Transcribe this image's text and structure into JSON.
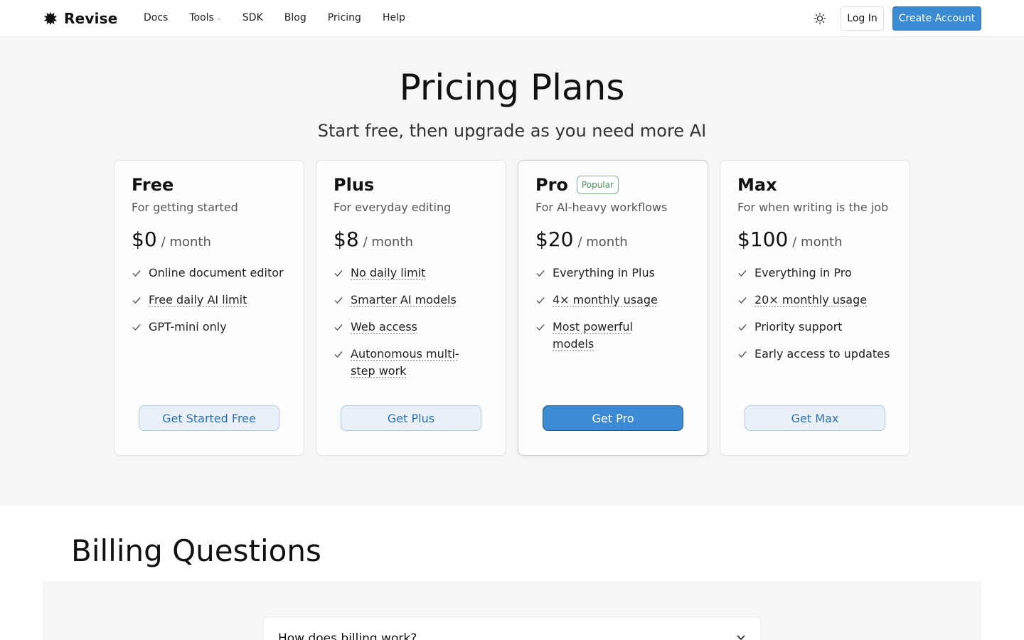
{
  "header": {
    "brand": "Revise",
    "nav": [
      {
        "label": "Docs"
      },
      {
        "label": "Tools",
        "has_dropdown": true
      },
      {
        "label": "SDK"
      },
      {
        "label": "Blog"
      },
      {
        "label": "Pricing"
      },
      {
        "label": "Help"
      }
    ],
    "login_label": "Log In",
    "create_account_label": "Create Account"
  },
  "hero": {
    "title": "Pricing Plans",
    "subtitle": "Start free, then upgrade as you need more AI"
  },
  "plans": [
    {
      "name": "Free",
      "description": "For getting started",
      "price": "$0",
      "period": "/ month",
      "features": [
        {
          "text": "Online document editor",
          "dotted": false
        },
        {
          "text": "Free daily AI limit",
          "dotted": true
        },
        {
          "text": "GPT-mini only",
          "dotted": false
        }
      ],
      "cta": "Get Started Free",
      "primary": false
    },
    {
      "name": "Plus",
      "description": "For everyday editing",
      "price": "$8",
      "period": "/ month",
      "features": [
        {
          "text": "No daily limit",
          "dotted": true
        },
        {
          "text": "Smarter AI models",
          "dotted": true
        },
        {
          "text": "Web access",
          "dotted": true
        },
        {
          "text": "Autonomous multi-step work",
          "dotted": true
        }
      ],
      "cta": "Get Plus",
      "primary": false
    },
    {
      "name": "Pro",
      "badge": "Popular",
      "description": "For AI-heavy workflows",
      "price": "$20",
      "period": "/ month",
      "features": [
        {
          "text": "Everything in Plus",
          "dotted": false
        },
        {
          "text": "4× monthly usage",
          "dotted": true
        },
        {
          "text": "Most powerful models",
          "dotted": true
        }
      ],
      "cta": "Get Pro",
      "primary": true
    },
    {
      "name": "Max",
      "description": "For when writing is the job",
      "price": "$100",
      "period": "/ month",
      "features": [
        {
          "text": "Everything in Pro",
          "dotted": false
        },
        {
          "text": "20× monthly usage",
          "dotted": true
        },
        {
          "text": "Priority support",
          "dotted": false
        },
        {
          "text": "Early access to updates",
          "dotted": false
        }
      ],
      "cta": "Get Max",
      "primary": false
    }
  ],
  "billing": {
    "title": "Billing Questions",
    "faq": [
      {
        "question": "How does billing work?"
      }
    ]
  },
  "colors": {
    "accent": "#3b8bd4",
    "badge_green": "#4a8f5a",
    "section_bg": "#f7f6f4"
  },
  "icons": {
    "logo": "revise-logo-icon",
    "theme": "sun-icon",
    "check": "check-icon",
    "dropdown": "chevron-down-icon"
  }
}
